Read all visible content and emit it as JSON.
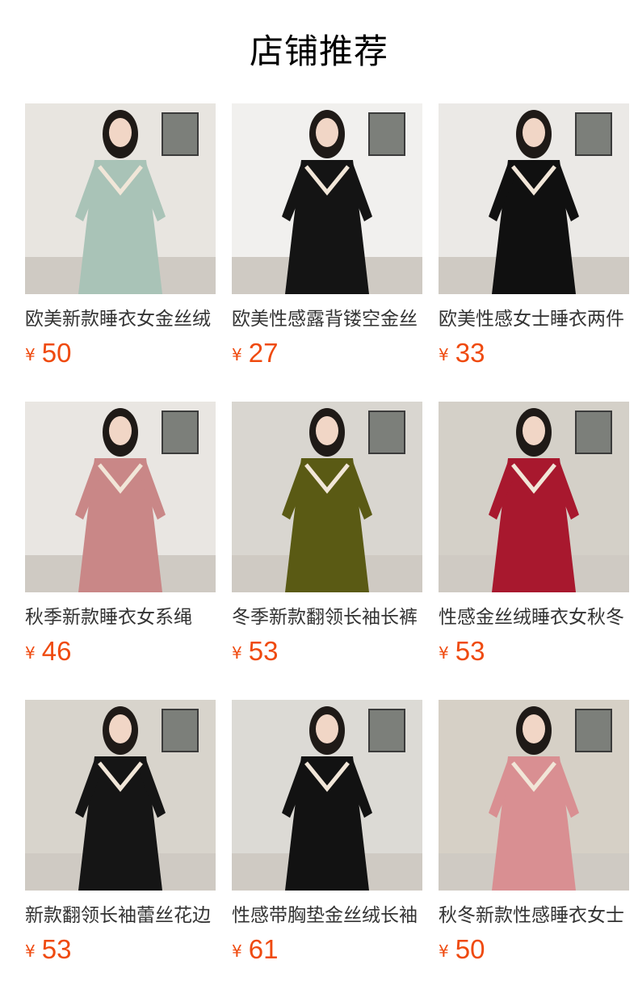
{
  "page": {
    "title": "店铺推荐"
  },
  "currency_symbol": "¥",
  "products": [
    {
      "name": "欧美新款睡衣女金丝绒",
      "price": "50",
      "dress_color": "#a9c3b7",
      "bg_color": "#e8e5e0",
      "item_icon": "camisole-robe-icon"
    },
    {
      "name": "欧美性感露背镂空金丝",
      "price": "27",
      "dress_color": "#141414",
      "bg_color": "#f1f0ee",
      "item_icon": "slip-dress-icon"
    },
    {
      "name": "欧美性感女士睡衣两件",
      "price": "33",
      "dress_color": "#101010",
      "bg_color": "#ebe9e6",
      "item_icon": "cami-pants-set-icon"
    },
    {
      "name": "秋季新款睡衣女系绳",
      "price": "46",
      "dress_color": "#c98787",
      "bg_color": "#e9e6e2",
      "item_icon": "long-sleeve-set-icon"
    },
    {
      "name": "冬季新款翻领长袖长裤",
      "price": "53",
      "dress_color": "#5a5a14",
      "bg_color": "#d9d6d0",
      "item_icon": "long-sleeve-set-icon"
    },
    {
      "name": "性感金丝绒睡衣女秋冬",
      "price": "53",
      "dress_color": "#a8182e",
      "bg_color": "#d4d0c8",
      "item_icon": "long-sleeve-set-icon"
    },
    {
      "name": "新款翻领长袖蕾丝花边",
      "price": "53",
      "dress_color": "#151515",
      "bg_color": "#d8d4cc",
      "item_icon": "long-sleeve-set-icon"
    },
    {
      "name": "性感带胸垫金丝绒长袖",
      "price": "61",
      "dress_color": "#121212",
      "bg_color": "#dcdad5",
      "item_icon": "cami-pants-set-icon"
    },
    {
      "name": "秋冬新款性感睡衣女士",
      "price": "50",
      "dress_color": "#d98f92",
      "bg_color": "#d6d0c6",
      "item_icon": "camisole-robe-icon"
    }
  ]
}
